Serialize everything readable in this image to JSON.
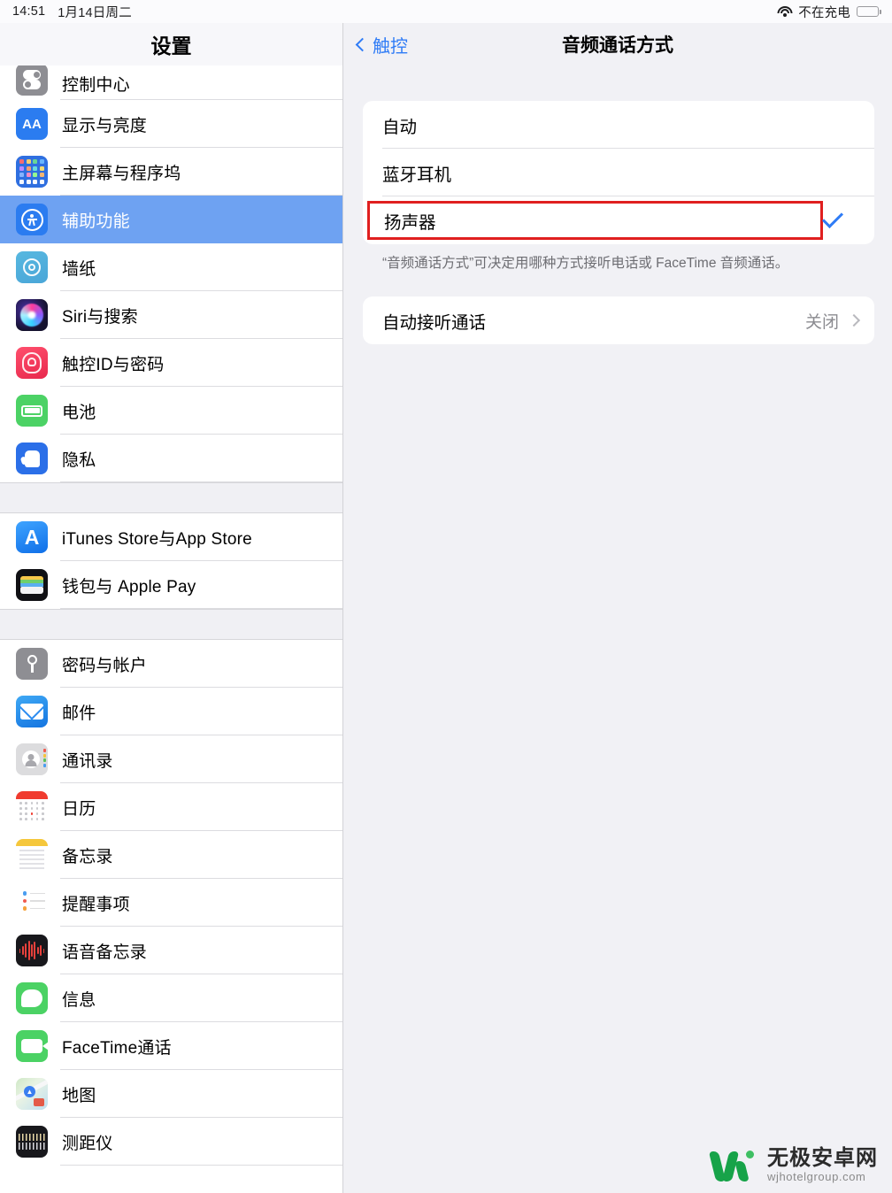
{
  "status_bar": {
    "time": "14:51",
    "date": "1月14日周二",
    "wifi_icon": "wifi-icon",
    "charging_text": "不在充电",
    "battery_icon": "battery-icon"
  },
  "sidebar": {
    "title": "设置",
    "selected": "辅助功能",
    "groups": [
      {
        "items": [
          {
            "label": "控制中心",
            "icon": "control-center-icon",
            "clipped": true
          },
          {
            "label": "显示与亮度",
            "icon": "display-brightness-icon"
          },
          {
            "label": "主屏幕与程序坞",
            "icon": "home-screen-dock-icon"
          },
          {
            "label": "辅助功能",
            "icon": "accessibility-icon",
            "selected": true
          },
          {
            "label": "墙纸",
            "icon": "wallpaper-icon"
          },
          {
            "label": "Siri与搜索",
            "icon": "siri-search-icon"
          },
          {
            "label": "触控ID与密码",
            "icon": "touch-id-passcode-icon"
          },
          {
            "label": "电池",
            "icon": "battery-settings-icon"
          },
          {
            "label": "隐私",
            "icon": "privacy-icon"
          }
        ]
      },
      {
        "items": [
          {
            "label": "iTunes Store与App Store",
            "icon": "app-store-icon"
          },
          {
            "label": "钱包与 Apple Pay",
            "icon": "wallet-apple-pay-icon"
          }
        ]
      },
      {
        "items": [
          {
            "label": "密码与帐户",
            "icon": "passwords-accounts-icon"
          },
          {
            "label": "邮件",
            "icon": "mail-icon"
          },
          {
            "label": "通讯录",
            "icon": "contacts-icon"
          },
          {
            "label": "日历",
            "icon": "calendar-icon"
          },
          {
            "label": "备忘录",
            "icon": "notes-icon"
          },
          {
            "label": "提醒事项",
            "icon": "reminders-icon"
          },
          {
            "label": "语音备忘录",
            "icon": "voice-memos-icon"
          },
          {
            "label": "信息",
            "icon": "messages-icon"
          },
          {
            "label": "FaceTime通话",
            "icon": "facetime-icon"
          },
          {
            "label": "地图",
            "icon": "maps-icon"
          },
          {
            "label": "测距仪",
            "icon": "measure-icon"
          }
        ]
      }
    ]
  },
  "content": {
    "back_label": "触控",
    "back_icon": "chevron-left-icon",
    "title": "音频通话方式",
    "options": [
      {
        "label": "自动",
        "selected": false
      },
      {
        "label": "蓝牙耳机",
        "selected": false
      },
      {
        "label": "扬声器",
        "selected": true,
        "highlighted": true
      }
    ],
    "checkmark_icon": "checkmark-icon",
    "footnote": "“音频通话方式”可决定用哪种方式接听电话或 FaceTime 音频通话。",
    "auto_answer": {
      "label": "自动接听通话",
      "value": "关闭",
      "chevron_icon": "chevron-right-icon"
    }
  },
  "watermark": {
    "logo_icon": "wjhotelgroup-logo-icon",
    "cn": "无极安卓网",
    "en": "wjhotelgroup.com"
  },
  "colors": {
    "accent_blue": "#2f7cf6",
    "selection_blue": "#6ea2f2",
    "highlight_red": "#e01f1f",
    "content_bg": "#f1f1f5"
  }
}
